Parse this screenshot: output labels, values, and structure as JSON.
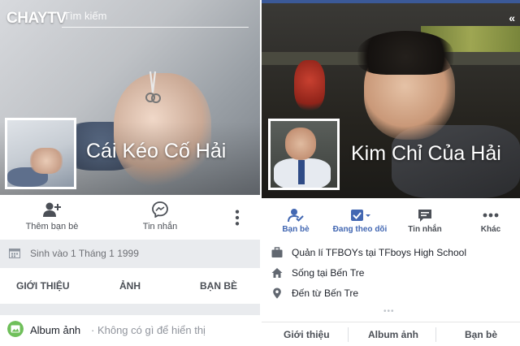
{
  "watermark": "CHAYTV",
  "colors": {
    "facebook_blue": "#3b5998",
    "action_blue": "#4267b2",
    "text_dark": "#1d2129",
    "text_gray": "#4b4f56",
    "green": "#6fbf5a"
  },
  "left": {
    "search_placeholder": "Tìm kiếm",
    "profile_name": "Cái Kéo Cố Hải",
    "actions": [
      {
        "icon": "add-friend-icon",
        "label": "Thêm bạn bè"
      },
      {
        "icon": "messenger-icon",
        "label": "Tin nhắn"
      },
      {
        "icon": "more-vertical-icon",
        "label": ""
      }
    ],
    "birthday": "Sinh vào 1 Tháng 1 1999",
    "tabs": [
      "GIỚI THIỆU",
      "ẢNH",
      "BẠN BÈ"
    ],
    "album": {
      "title": "Album ảnh",
      "subtitle": "· Không có gì để hiển thị"
    }
  },
  "right": {
    "back_glyph": "«",
    "profile_name": "Kim Chỉ Của Hải",
    "actions": [
      {
        "icon": "friends-icon",
        "label": "Bạn bè"
      },
      {
        "icon": "following-icon",
        "label": "Đang theo dõi"
      },
      {
        "icon": "message-icon",
        "label": "Tin nhắn"
      },
      {
        "icon": "more-horizontal-icon",
        "label": "Khác"
      }
    ],
    "info": [
      {
        "icon": "briefcase-icon",
        "text": "Quản lí TFBOYs tại TFboys High School"
      },
      {
        "icon": "home-icon",
        "text": "Sống tại Bến Tre"
      },
      {
        "icon": "location-pin-icon",
        "text": "Đến từ Bến Tre"
      }
    ],
    "dots": "•••",
    "tabs": [
      "Giới thiệu",
      "Album ảnh",
      "Bạn bè"
    ]
  }
}
